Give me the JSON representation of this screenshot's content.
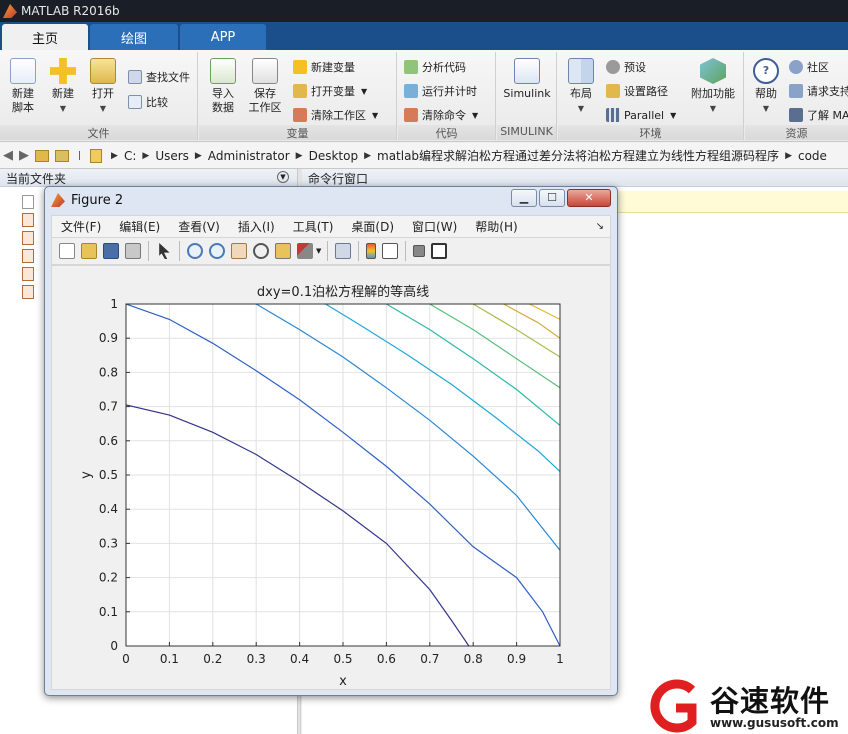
{
  "app": {
    "title": "MATLAB R2016b"
  },
  "tabs": [
    {
      "label": "主页"
    },
    {
      "label": "绘图"
    },
    {
      "label": "APP"
    }
  ],
  "ribbon": {
    "file": {
      "title": "文件",
      "new_script": "新建\n脚本",
      "new": "新建",
      "open": "打开",
      "find_files": "查找文件",
      "compare": "比较"
    },
    "variable": {
      "title": "变量",
      "import": "导入\n数据",
      "save_ws": "保存\n工作区",
      "new_var": "新建变量",
      "open_var": "打开变量",
      "clear_ws": "清除工作区"
    },
    "code": {
      "title": "代码",
      "analyze": "分析代码",
      "run_time": "运行并计时",
      "clear_cmd": "清除命令"
    },
    "simulink": {
      "title": "SIMULINK",
      "btn": "Simulink"
    },
    "env": {
      "title": "环境",
      "layout": "布局",
      "prefs": "预设",
      "set_path": "设置路径",
      "parallel": "Parallel",
      "addons": "附加功能"
    },
    "resources": {
      "title": "资源",
      "help": "帮助",
      "community": "社区",
      "request": "请求支持",
      "learn": "了解 MA"
    }
  },
  "address": {
    "path": [
      "C:",
      "Users",
      "Administrator",
      "Desktop",
      "matlab编程求解泊松方程通过差分法将泊松方程建立为线性方程组源码程序",
      "code"
    ]
  },
  "panels": {
    "current_folder": "当前文件夹",
    "command_window": "命令行窗口"
  },
  "figure": {
    "title": "Figure 2",
    "menu": [
      "文件(F)",
      "编辑(E)",
      "查看(V)",
      "插入(I)",
      "工具(T)",
      "桌面(D)",
      "窗口(W)",
      "帮助(H)"
    ]
  },
  "chart_data": {
    "type": "line",
    "title": "dxy=0.1泊松方程解的等高线",
    "xlabel": "x",
    "ylabel": "y",
    "xlim": [
      0,
      1
    ],
    "ylim": [
      0,
      1
    ],
    "xticks": [
      0,
      0.1,
      0.2,
      0.3,
      0.4,
      0.5,
      0.6,
      0.7,
      0.8,
      0.9,
      1
    ],
    "yticks": [
      0,
      0.1,
      0.2,
      0.3,
      0.4,
      0.5,
      0.6,
      0.7,
      0.8,
      0.9,
      1
    ],
    "grid": true,
    "series": [
      {
        "color": "#34348a",
        "points": [
          [
            0,
            0.705
          ],
          [
            0.1,
            0.675
          ],
          [
            0.2,
            0.625
          ],
          [
            0.3,
            0.56
          ],
          [
            0.4,
            0.48
          ],
          [
            0.5,
            0.395
          ],
          [
            0.6,
            0.3
          ],
          [
            0.7,
            0.165
          ],
          [
            0.75,
            0.075
          ],
          [
            0.79,
            0
          ]
        ]
      },
      {
        "color": "#2f5fc4",
        "points": [
          [
            0,
            1
          ],
          [
            0.1,
            0.955
          ],
          [
            0.2,
            0.885
          ],
          [
            0.3,
            0.805
          ],
          [
            0.4,
            0.72
          ],
          [
            0.5,
            0.625
          ],
          [
            0.6,
            0.525
          ],
          [
            0.7,
            0.415
          ],
          [
            0.8,
            0.29
          ],
          [
            0.9,
            0.2
          ],
          [
            0.96,
            0.1
          ],
          [
            1,
            0
          ]
        ]
      },
      {
        "color": "#2a86d4",
        "points": [
          [
            0.3,
            1
          ],
          [
            0.4,
            0.925
          ],
          [
            0.5,
            0.845
          ],
          [
            0.6,
            0.755
          ],
          [
            0.7,
            0.66
          ],
          [
            0.8,
            0.555
          ],
          [
            0.9,
            0.44
          ],
          [
            1,
            0.28
          ]
        ]
      },
      {
        "color": "#1ea7d6",
        "points": [
          [
            0.46,
            1
          ],
          [
            0.55,
            0.93
          ],
          [
            0.65,
            0.85
          ],
          [
            0.75,
            0.765
          ],
          [
            0.85,
            0.67
          ],
          [
            0.95,
            0.57
          ],
          [
            1,
            0.51
          ]
        ]
      },
      {
        "color": "#2bb9a8",
        "points": [
          [
            0.6,
            1
          ],
          [
            0.7,
            0.925
          ],
          [
            0.8,
            0.84
          ],
          [
            0.9,
            0.75
          ],
          [
            1,
            0.645
          ]
        ]
      },
      {
        "color": "#58bf7a",
        "points": [
          [
            0.7,
            1
          ],
          [
            0.8,
            0.925
          ],
          [
            0.9,
            0.84
          ],
          [
            1,
            0.755
          ]
        ]
      },
      {
        "color": "#a6bf4e",
        "points": [
          [
            0.8,
            1
          ],
          [
            0.9,
            0.925
          ],
          [
            1,
            0.845
          ]
        ]
      },
      {
        "color": "#d6ad3a",
        "points": [
          [
            0.87,
            1
          ],
          [
            0.95,
            0.945
          ],
          [
            1,
            0.9
          ]
        ]
      },
      {
        "color": "#e9b82a",
        "points": [
          [
            0.93,
            1
          ],
          [
            1,
            0.955
          ]
        ]
      }
    ]
  },
  "watermark": {
    "name": "谷速软件",
    "url": "www.gususoft.com"
  },
  "colors": {
    "tabbar": "#1b4f8c",
    "titlebar": "#1a1f27",
    "accent": "#2a6fb8"
  }
}
